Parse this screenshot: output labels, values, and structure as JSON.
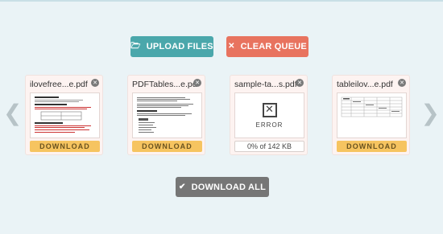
{
  "toolbar": {
    "upload_label": "UPLOAD FILES",
    "clear_label": "CLEAR QUEUE",
    "download_all_label": "DOWNLOAD ALL"
  },
  "nav": {
    "prev_glyph": "❮",
    "next_glyph": "❯"
  },
  "icons": {
    "upload": "folder-open-icon",
    "clear": "close-icon",
    "download_all": "checkmark-icon"
  },
  "colors": {
    "upload": "#4aa7ab",
    "clear": "#e8735f",
    "download_all": "#767676",
    "download": "#f6c460"
  },
  "files": [
    {
      "name": "ilovefree...e.pdf",
      "action": "DOWNLOAD",
      "status": "done"
    },
    {
      "name": "PDFTables...e.pdf",
      "action": "DOWNLOAD",
      "status": "done"
    },
    {
      "name": "sample-ta...s.pdf",
      "status": "error",
      "error_label": "ERROR",
      "progress_text": "0% of 142 KB",
      "progress": 0
    },
    {
      "name": "tableilov...e.pdf",
      "action": "DOWNLOAD",
      "status": "done"
    }
  ]
}
